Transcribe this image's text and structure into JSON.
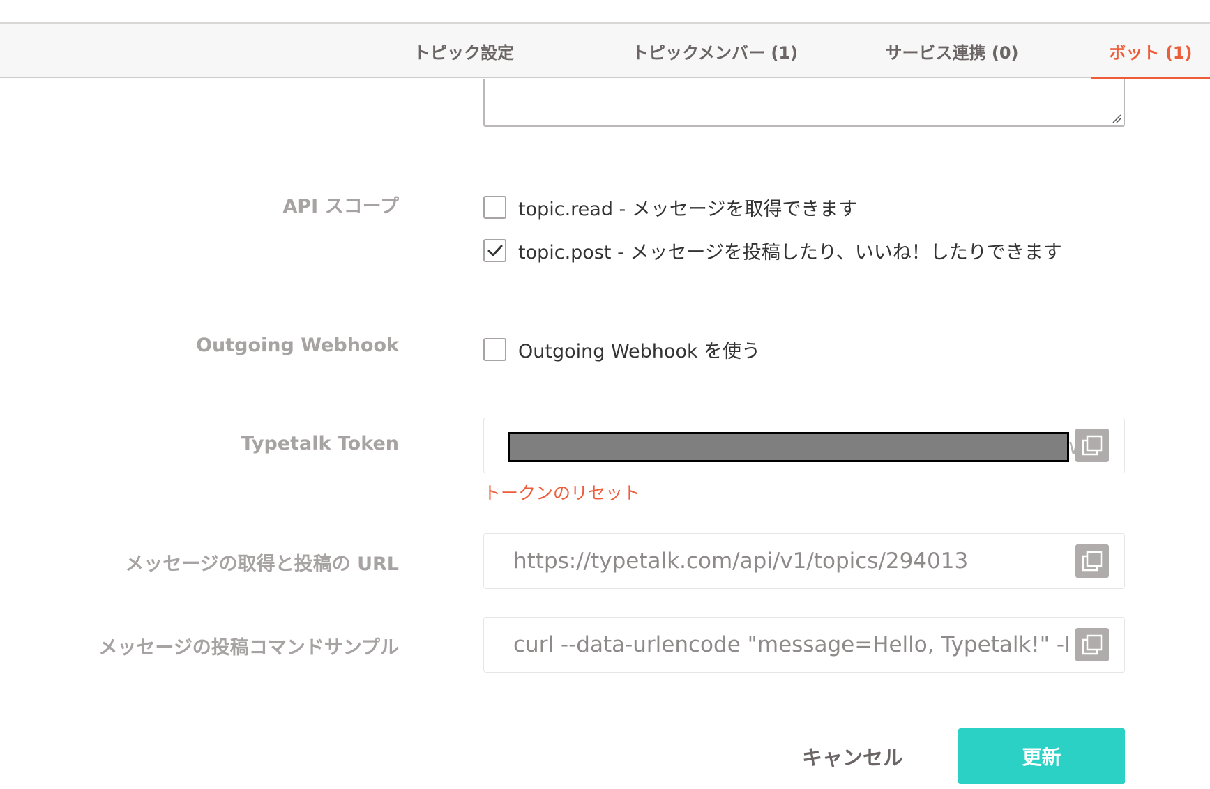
{
  "tabs": [
    {
      "label": "トピック設定",
      "active": false
    },
    {
      "label": "トピックメンバー (1)",
      "active": false
    },
    {
      "label": "サービス連携 (0)",
      "active": false
    },
    {
      "label": "ボット (1)",
      "active": true
    }
  ],
  "api_scope": {
    "label": "API スコープ",
    "options": [
      {
        "text": "topic.read - メッセージを取得できます",
        "checked": false
      },
      {
        "text": "topic.post - メッセージを投稿したり、いいね！したりできます",
        "checked": true
      }
    ]
  },
  "outgoing_webhook": {
    "label": "Outgoing Webhook",
    "option_text": "Outgoing Webhook を使う",
    "checked": false
  },
  "token": {
    "label": "Typetalk Token",
    "peek_char": "w",
    "reset_link": "トークンのリセット"
  },
  "url_field": {
    "label": "メッセージの取得と投稿の URL",
    "value": "https://typetalk.com/api/v1/topics/294013"
  },
  "sample_field": {
    "label": "メッセージの投稿コマンドサンプル",
    "value": "curl --data-urlencode \"message=Hello, Typetalk!\" -H \"X"
  },
  "buttons": {
    "cancel": "キャンセル",
    "update": "更新"
  },
  "colors": {
    "accent": "#ee5d3a",
    "primary_button": "#2ad1c4",
    "label_gray": "#a8a3a3"
  },
  "icons": [
    "copy-icon",
    "checkmark-icon",
    "resize-handle-icon"
  ]
}
